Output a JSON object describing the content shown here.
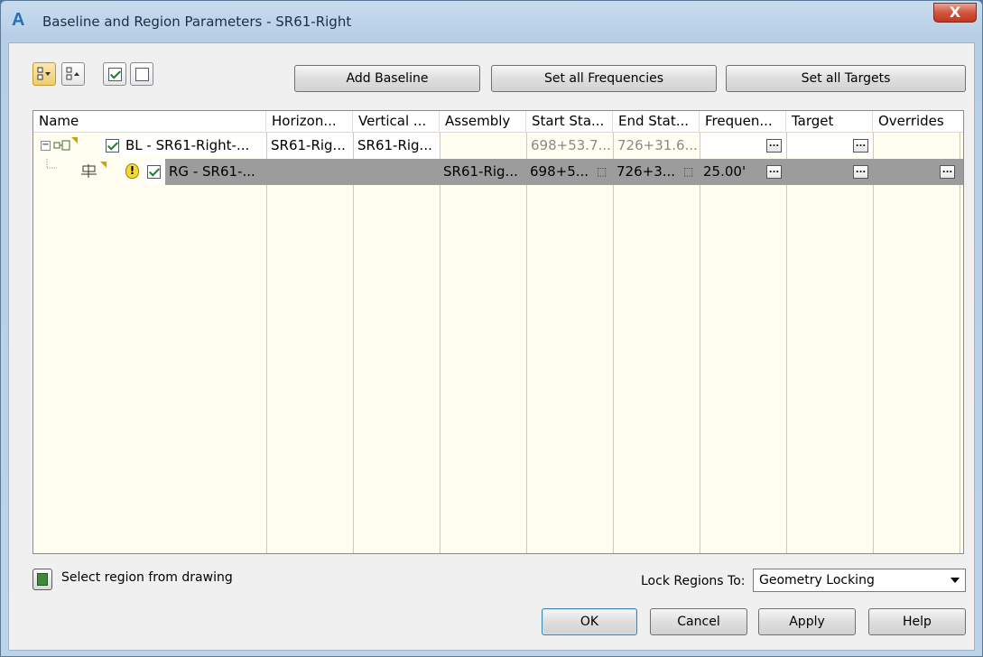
{
  "window": {
    "title": "Baseline and Region Parameters - SR61-Right",
    "close_symbol": "X",
    "app_icon_letter": "A"
  },
  "toolbar": {
    "add_baseline": "Add Baseline",
    "set_all_frequencies": "Set all Frequencies",
    "set_all_targets": "Set all Targets"
  },
  "grid": {
    "columns": [
      "Name",
      "Horizon...",
      "Vertical ...",
      "Assembly",
      "Start Sta...",
      "End Stat...",
      "Frequen...",
      "Target",
      "Overrides"
    ],
    "baseline_row": {
      "name": "BL - SR61-Right-...",
      "horizontal": "SR61-Rig...",
      "vertical": "SR61-Rig...",
      "assembly": "",
      "start": "698+53.7...",
      "end": "726+31.6...",
      "frequency": "",
      "target": "",
      "overrides": ""
    },
    "region_row": {
      "name": "RG - SR61-...",
      "horizontal": "",
      "vertical": "",
      "assembly": "SR61-Rig...",
      "start": "698+5...",
      "end": "726+3...",
      "frequency": "25.00'",
      "target": "",
      "overrides": ""
    },
    "ellipsis": "..."
  },
  "footer": {
    "select_region": "Select region from drawing",
    "lock_label": "Lock Regions To:",
    "lock_value": "Geometry Locking",
    "ok": "OK",
    "cancel": "Cancel",
    "apply": "Apply",
    "help": "Help"
  }
}
